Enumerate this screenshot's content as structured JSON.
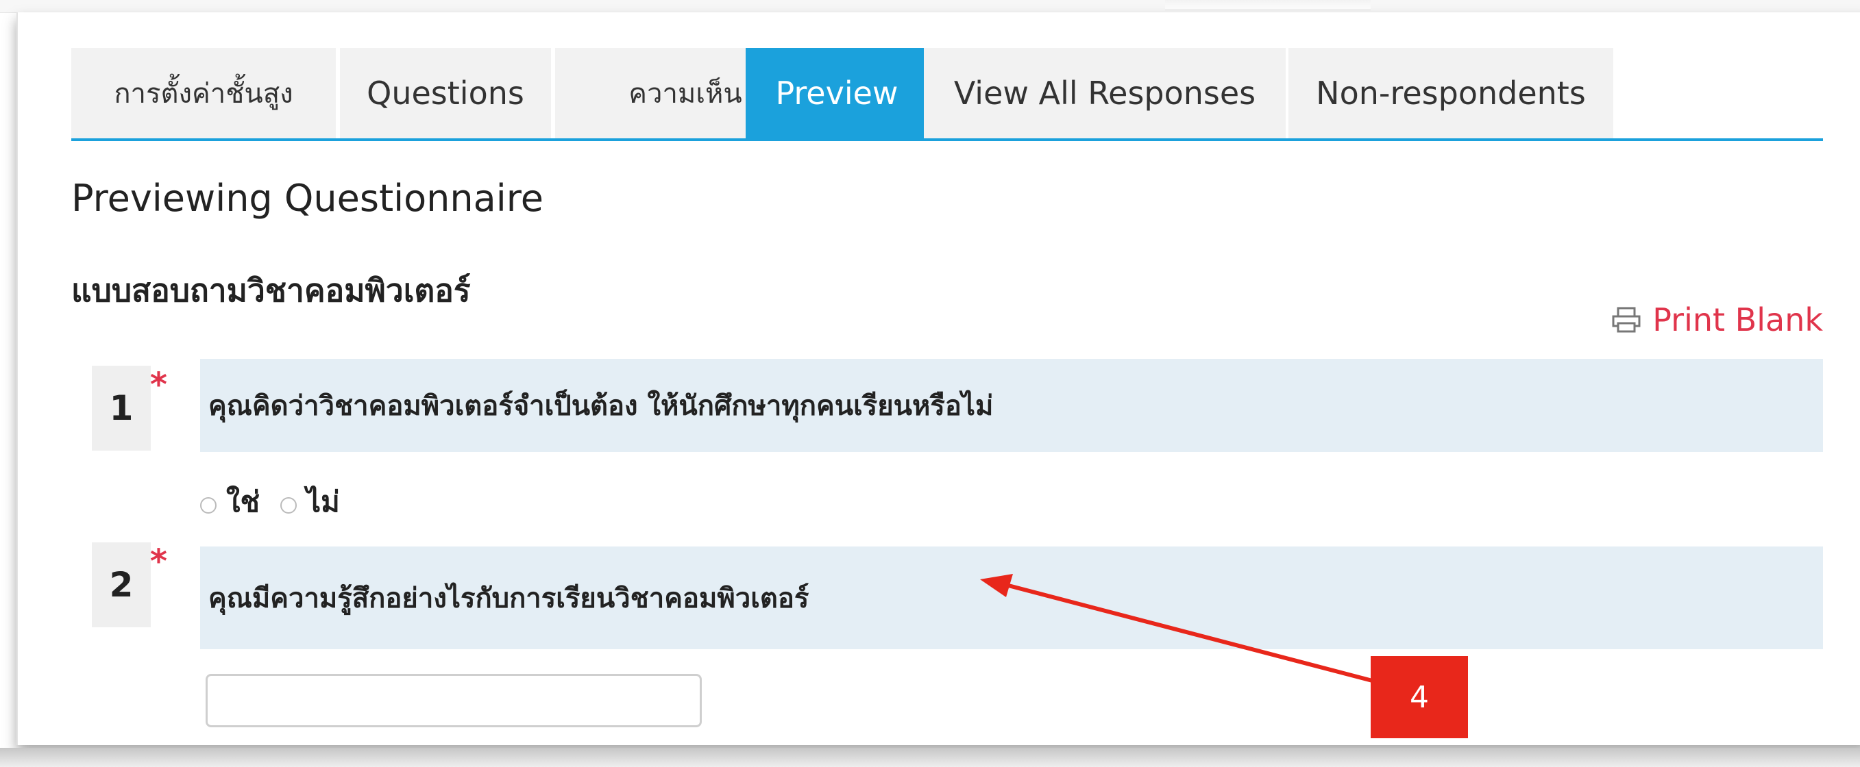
{
  "tabs": [
    {
      "label": "การตั้งค่าชั้นสูง",
      "active": false
    },
    {
      "label": "Questions",
      "active": false
    },
    {
      "label": "ความเห็น",
      "active": false
    },
    {
      "label": "Preview",
      "active": true
    },
    {
      "label": "View All Responses",
      "active": false
    },
    {
      "label": "Non-respondents",
      "active": false
    }
  ],
  "page": {
    "title": "Previewing Questionnaire",
    "questionnaire_title": "แบบสอบถามวิชาคอมพิวเตอร์",
    "print_label": "Print Blank"
  },
  "questions": [
    {
      "number": "1",
      "required_mark": "*",
      "text": "คุณคิดว่าวิชาคอมพิวเตอร์จำเป็นต้อง ให้นักศึกษาทุกคนเรียนหรือไม่",
      "options": [
        "ใช่",
        "ไม่"
      ]
    },
    {
      "number": "2",
      "required_mark": "*",
      "text": "คุณมีความรู้สึกอย่างไรกับการเรียนวิชาคอมพิวเตอร์",
      "answer_value": "",
      "answer_placeholder": ""
    }
  ],
  "annotation": {
    "callout_number": "4"
  },
  "colors": {
    "accent": "#1ba1dc",
    "required": "#e0344b",
    "question_bg": "#e4eef5",
    "annotation": "#e8271b"
  },
  "icons": {
    "print": "printer-icon"
  }
}
